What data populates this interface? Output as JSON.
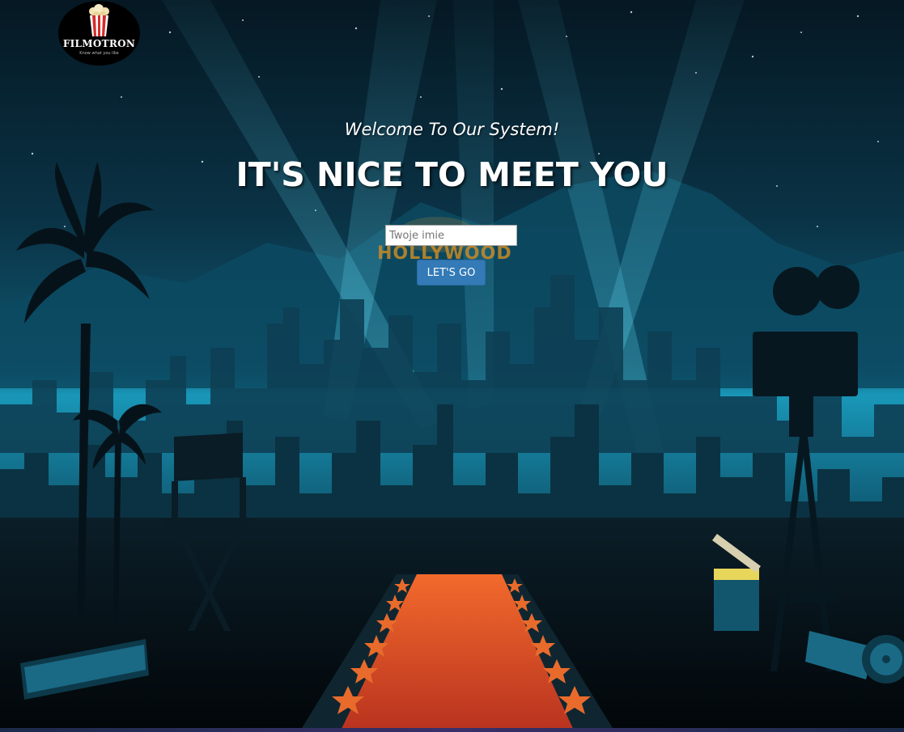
{
  "logo": {
    "brand": "FILMOTRON",
    "tagline": "Know what you like",
    "icon": "popcorn-icon"
  },
  "hero": {
    "welcome": "Welcome To Our System!",
    "headline": "IT'S NICE TO MEET YOU"
  },
  "form": {
    "name_placeholder": "Twoje imie",
    "name_value": "",
    "submit_label": "LET'S GO"
  },
  "background": {
    "sign_text": "HOLLYWOOD",
    "colors": {
      "sky_top": "#061a26",
      "sky_mid": "#0e5d78",
      "horizon": "#1aa6c9",
      "carpet": "#e8472a",
      "button": "#337ab7"
    }
  }
}
